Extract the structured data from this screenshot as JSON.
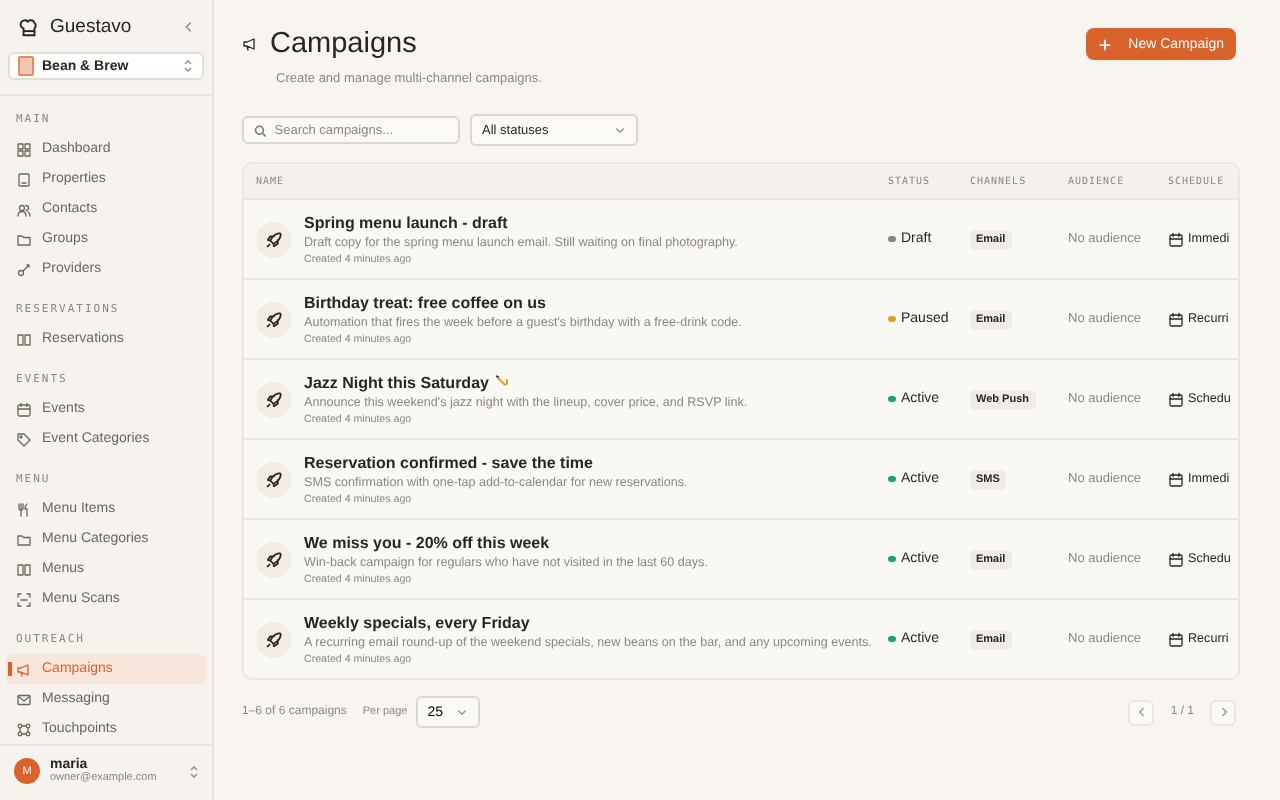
{
  "sidebar": {
    "app_name": "Guestavo",
    "workspace": "Bean & Brew",
    "sections": [
      {
        "heading": "MAIN",
        "items": [
          {
            "label": "Dashboard",
            "selected": false
          },
          {
            "label": "Properties",
            "selected": false
          },
          {
            "label": "Contacts",
            "selected": false
          },
          {
            "label": "Groups",
            "selected": false
          },
          {
            "label": "Providers",
            "selected": false
          }
        ]
      },
      {
        "heading": "RESERVATIONS",
        "items": [
          {
            "label": "Reservations",
            "selected": false
          }
        ]
      },
      {
        "heading": "EVENTS",
        "items": [
          {
            "label": "Events",
            "selected": false
          },
          {
            "label": "Event Categories",
            "selected": false
          }
        ]
      },
      {
        "heading": "MENU",
        "items": [
          {
            "label": "Menu Items",
            "selected": false
          },
          {
            "label": "Menu Categories",
            "selected": false
          },
          {
            "label": "Menus",
            "selected": false
          },
          {
            "label": "Menu Scans",
            "selected": false
          }
        ]
      },
      {
        "heading": "OUTREACH",
        "items": [
          {
            "label": "Campaigns",
            "selected": true
          },
          {
            "label": "Messaging",
            "selected": false
          },
          {
            "label": "Touchpoints",
            "selected": false
          }
        ]
      }
    ],
    "user": {
      "initial": "M",
      "name": "maria",
      "email": "owner@example.com"
    }
  },
  "header": {
    "title": "Campaigns",
    "subtitle": "Create and manage multi-channel campaigns.",
    "new_button": "New Campaign"
  },
  "filters": {
    "search_placeholder": "Search campaigns...",
    "status_filter": "All statuses"
  },
  "table": {
    "columns": [
      "NAME",
      "STATUS",
      "CHANNELS",
      "AUDIENCE",
      "SCHEDULE"
    ],
    "rows": [
      {
        "title": "Spring menu launch - draft",
        "emoji": false,
        "description": "Draft copy for the spring menu launch email. Still waiting on final photography.",
        "created": "Created 4 minutes ago",
        "status": "Draft",
        "color": "#8a8580",
        "channel": "Email",
        "audience": "No audience",
        "schedule": "Immedi"
      },
      {
        "title": "Birthday treat: free coffee on us",
        "emoji": false,
        "description": "Automation that fires the week before a guest's birthday with a free-drink code.",
        "created": "Created 4 minutes ago",
        "status": "Paused",
        "color": "#e0a020",
        "channel": "Email",
        "audience": "No audience",
        "schedule": "Recurri"
      },
      {
        "title": "Jazz Night this Saturday",
        "emoji": true,
        "description": "Announce this weekend's jazz night with the lineup, cover price, and RSVP link.",
        "created": "Created 4 minutes ago",
        "status": "Active",
        "color": "#18a86b",
        "channel": "Web Push",
        "audience": "No audience",
        "schedule": "Schedu"
      },
      {
        "title": "Reservation confirmed - save the time",
        "emoji": false,
        "description": "SMS confirmation with one-tap add-to-calendar for new reservations.",
        "created": "Created 4 minutes ago",
        "status": "Active",
        "color": "#18a86b",
        "channel": "SMS",
        "audience": "No audience",
        "schedule": "Immedi"
      },
      {
        "title": "We miss you - 20% off this week",
        "emoji": false,
        "description": "Win-back campaign for regulars who have not visited in the last 60 days.",
        "created": "Created 4 minutes ago",
        "status": "Active",
        "color": "#18a86b",
        "channel": "Email",
        "audience": "No audience",
        "schedule": "Schedu"
      },
      {
        "title": "Weekly specials, every Friday",
        "emoji": false,
        "description": "A recurring email round-up of the weekend specials, new beans on the bar, and any upcoming events.",
        "created": "Created 4 minutes ago",
        "status": "Active",
        "color": "#18a86b",
        "channel": "Email",
        "audience": "No audience",
        "schedule": "Recurri"
      }
    ]
  },
  "footer": {
    "summary": "1–6 of 6 campaigns",
    "per_page_label": "Per page",
    "per_page": "25",
    "page": "1 / 1"
  }
}
